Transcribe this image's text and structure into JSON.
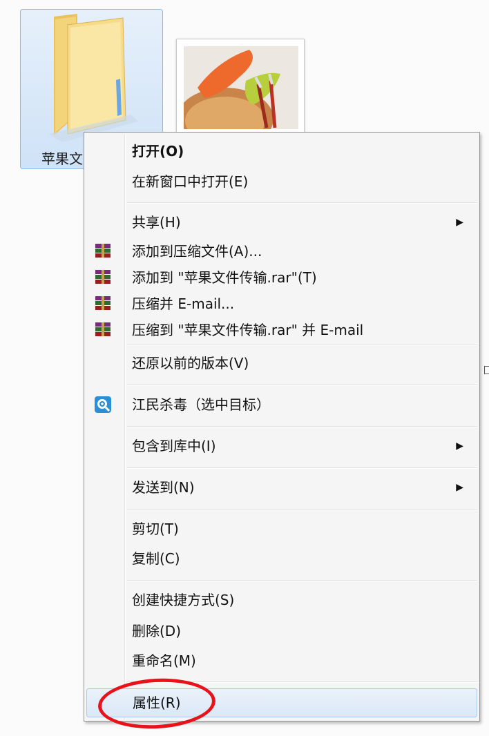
{
  "desktop": {
    "folder_label": "苹果文"
  },
  "menu": {
    "items": [
      {
        "label": "打开(O)",
        "bold": true
      },
      {
        "label": "在新窗口中打开(E)"
      },
      {
        "label": "共享(H)",
        "submenu": true
      },
      {
        "label": "添加到压缩文件(A)...",
        "icon": "winrar-icon"
      },
      {
        "label": "添加到 \"苹果文件传输.rar\"(T)",
        "icon": "winrar-icon"
      },
      {
        "label": "压缩并 E-mail...",
        "icon": "winrar-icon"
      },
      {
        "label": "压缩到 \"苹果文件传输.rar\" 并 E-mail",
        "icon": "winrar-icon"
      },
      {
        "label": "还原以前的版本(V)"
      },
      {
        "label": "江民杀毒（选中目标）",
        "icon": "antivirus-icon"
      },
      {
        "label": "包含到库中(I)",
        "submenu": true
      },
      {
        "label": "发送到(N)",
        "submenu": true
      },
      {
        "label": "剪切(T)"
      },
      {
        "label": "复制(C)"
      },
      {
        "label": "创建快捷方式(S)"
      },
      {
        "label": "删除(D)"
      },
      {
        "label": "重命名(M)"
      },
      {
        "label": "属性(R)",
        "highlighted": true
      }
    ],
    "submenu_arrow": "▶"
  },
  "colors": {
    "annotation": "#e8121a",
    "highlight_border": "#a8c8ec"
  }
}
